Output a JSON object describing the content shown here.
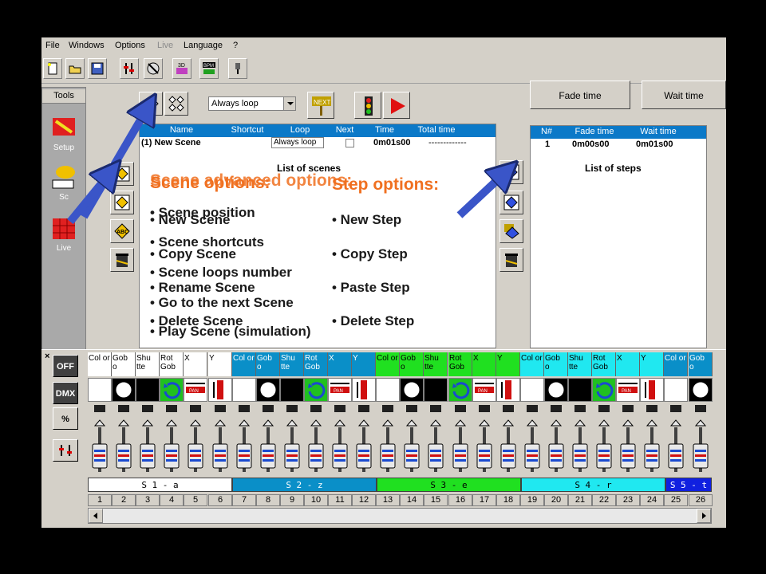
{
  "menu": {
    "items": [
      "File",
      "Windows",
      "Options",
      "Live",
      "Language",
      "?"
    ]
  },
  "tools": {
    "title": "Tools",
    "items": [
      {
        "label": "Setup",
        "icon": "setup-wrench-icon"
      },
      {
        "label": "Sc",
        "icon": "hardhat-scroll-icon"
      },
      {
        "label": "Live",
        "icon": "live-grid-icon"
      }
    ]
  },
  "scenes": {
    "loop_select": "Always loop",
    "columns": [
      "Name",
      "Shortcut",
      "Loop",
      "Next",
      "Time",
      "Total time"
    ],
    "row": {
      "name": "(1) New Scene",
      "loop": "Always loop",
      "time": "0m01s00",
      "total": "-------------"
    },
    "caption": "List of scenes"
  },
  "steps": {
    "fade_button": "Fade time",
    "wait_button": "Wait time",
    "columns": [
      "N#",
      "Fade time",
      "Wait time"
    ],
    "row": {
      "n": "1",
      "fade": "0m00s00",
      "wait": "0m01s00"
    },
    "caption": "List of steps"
  },
  "overlay": {
    "scene_options_title": "Scene options:",
    "scene_advanced_title": "Scene advanced options:",
    "step_options_title": "Step options:",
    "scene_options": [
      "• New Scene",
      "• Copy Scene",
      "• Rename Scene",
      "• Delete Scene"
    ],
    "scene_advanced": [
      "• Scene position",
      "• Scene shortcuts",
      "• Scene loops number",
      "• Go to the next Scene",
      "• Play Scene (simulation)"
    ],
    "step_options": [
      "• New Step",
      "• Copy Step",
      "• Paste Step",
      "• Delete Step"
    ]
  },
  "side_buttons": [
    "OFF",
    "DMX",
    "%"
  ],
  "channel_labels": [
    "Col or",
    "Gob o",
    "Shu tte",
    "Rot Gob",
    "X",
    "Y",
    "Col or",
    "Gob o",
    "Shu tte",
    "Rot Gob",
    "X",
    "Y",
    "Col or",
    "Gob o",
    "Shu tte",
    "Rot Gob",
    "X",
    "Y",
    "Col or",
    "Gob o",
    "Shu tte",
    "Rot Gob",
    "X",
    "Y",
    "Col or",
    "Gob o"
  ],
  "channel_groups": [
    {
      "label": "S 1 - a",
      "color": "#ffffff"
    },
    {
      "label": "S 2 - z",
      "color": "#0a8fc8"
    },
    {
      "label": "S 3 - e",
      "color": "#20e020"
    },
    {
      "label": "S 4 - r",
      "color": "#20e8f0"
    },
    {
      "label": "S 5 - t",
      "color": "#1020e0"
    }
  ],
  "channel_numbers": [
    "1",
    "2",
    "3",
    "4",
    "5",
    "6",
    "7",
    "8",
    "9",
    "10",
    "11",
    "12",
    "13",
    "14",
    "15",
    "16",
    "17",
    "18",
    "19",
    "20",
    "21",
    "22",
    "23",
    "24",
    "25",
    "26"
  ],
  "colors": {
    "arrow": "#3a55c8",
    "overlay_title": "#f07020"
  }
}
